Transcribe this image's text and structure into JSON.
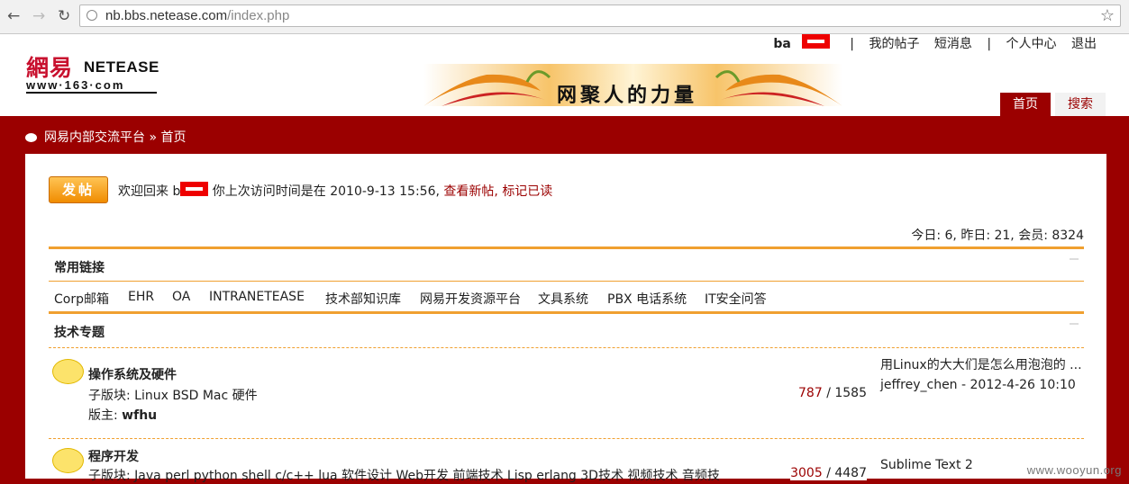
{
  "browser": {
    "url_host": "nb.bbs.netease.com",
    "url_path": "/index.php"
  },
  "header": {
    "logo_cn": "網易",
    "logo_en": "NETEASE",
    "logo_sub": "www·163·com",
    "banner_text": "网聚人的力量",
    "user": "ba",
    "links": [
      "我的帖子",
      "短消息",
      "个人中心",
      "退出"
    ],
    "separator": "|",
    "tabs": [
      "首页",
      "搜索"
    ]
  },
  "breadcrumb": {
    "site": "网易内部交流平台",
    "sep": "»",
    "current": "首页"
  },
  "welcome": {
    "post_button": "发帖",
    "prefix": "欢迎回来 b",
    "middle": "你上次访问时间是在 2010-9-13 15:56,",
    "new_posts": "查看新帖",
    "mark_read": "标记已读"
  },
  "stats": "今日: 6, 昨日: 21, 会员: 8324",
  "common_links": {
    "title": "常用链接",
    "items": [
      "Corp邮箱",
      "EHR",
      "OA",
      "INTRANETEASE",
      "技术部知识库",
      "网易开发资源平台",
      "文具系统",
      "PBX 电话系统",
      "IT安全问答"
    ]
  },
  "tech": {
    "title": "技术专题",
    "forums": [
      {
        "name": "操作系统及硬件",
        "sub": "子版块: Linux  BSD  Mac  硬件",
        "mod_label": "版主: ",
        "mod": "wfhu",
        "threads": "787",
        "posts": "/ 1585",
        "last_title": "用Linux的大大们是怎么用泡泡的 ...",
        "last_by": "jeffrey_chen - 2012-4-26 10:10"
      },
      {
        "name": "程序开发",
        "sub": "子版块: Java  perl  python  shell  c/c++  lua  软件设计  Web开发  前端技术  Lisp  erlang  3D技术  视频技术  音频技",
        "threads": "3005",
        "posts": "/ 4487",
        "last_title": "Sublime Text 2"
      }
    ]
  },
  "watermark": "www.wooyun.org",
  "colors": {
    "brand_red": "#9b0000",
    "accent_orange": "#f0a030"
  }
}
